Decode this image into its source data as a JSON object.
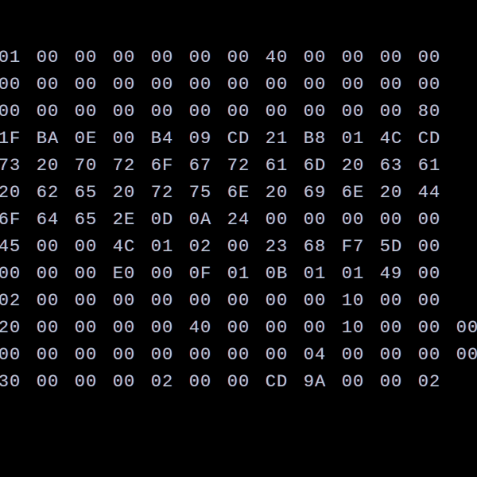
{
  "hex": {
    "rows": [
      [
        "01",
        "00",
        "00",
        "00",
        "00",
        "00",
        "00",
        "40",
        "00",
        "00",
        "00",
        "00"
      ],
      [
        "00",
        "00",
        "00",
        "00",
        "00",
        "00",
        "00",
        "00",
        "00",
        "00",
        "00",
        "00"
      ],
      [
        "00",
        "00",
        "00",
        "00",
        "00",
        "00",
        "00",
        "00",
        "00",
        "00",
        "00",
        "80"
      ],
      [
        "1F",
        "BA",
        "0E",
        "00",
        "B4",
        "09",
        "CD",
        "21",
        "B8",
        "01",
        "4C",
        "CD"
      ],
      [
        "73",
        "20",
        "70",
        "72",
        "6F",
        "67",
        "72",
        "61",
        "6D",
        "20",
        "63",
        "61"
      ],
      [
        "20",
        "62",
        "65",
        "20",
        "72",
        "75",
        "6E",
        "20",
        "69",
        "6E",
        "20",
        "44"
      ],
      [
        "6F",
        "64",
        "65",
        "2E",
        "0D",
        "0A",
        "24",
        "00",
        "00",
        "00",
        "00",
        "00"
      ],
      [
        "45",
        "00",
        "00",
        "4C",
        "01",
        "02",
        "00",
        "23",
        "68",
        "F7",
        "5D",
        "00"
      ],
      [
        "00",
        "00",
        "00",
        "E0",
        "00",
        "0F",
        "01",
        "0B",
        "01",
        "01",
        "49",
        "00"
      ],
      [
        "02",
        "00",
        "00",
        "00",
        "00",
        "00",
        "00",
        "00",
        "00",
        "10",
        "00",
        "00"
      ],
      [
        "20",
        "00",
        "00",
        "00",
        "00",
        "40",
        "00",
        "00",
        "00",
        "10",
        "00",
        "00",
        "00"
      ],
      [
        "00",
        "00",
        "00",
        "00",
        "00",
        "00",
        "00",
        "00",
        "04",
        "00",
        "00",
        "00",
        "00"
      ],
      [
        "30",
        "00",
        "00",
        "00",
        "02",
        "00",
        "00",
        "CD",
        "9A",
        "00",
        "00",
        "02"
      ]
    ]
  }
}
